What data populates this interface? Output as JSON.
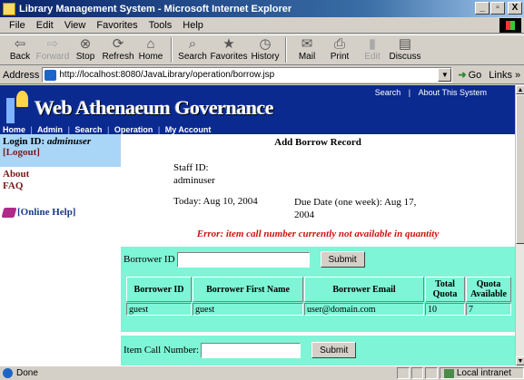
{
  "window": {
    "title": "Library Management System - Microsoft Internet Explorer",
    "minimize": "_",
    "restore": "!",
    "close": "X"
  },
  "menu": [
    "File",
    "Edit",
    "View",
    "Favorites",
    "Tools",
    "Help"
  ],
  "toolbar": {
    "back": "Back",
    "forward": "Forward",
    "stop": "Stop",
    "refresh": "Refresh",
    "home": "Home",
    "search": "Search",
    "favorites": "Favorites",
    "history": "History",
    "mail": "Mail",
    "print": "Print",
    "edit": "Edit",
    "discuss": "Discuss"
  },
  "address": {
    "label": "Address",
    "url": "http://localhost:8080/JavaLibrary/operation/borrow.jsp",
    "go": "Go",
    "links": "Links »"
  },
  "site": {
    "name": "Web Athenaeum Governance",
    "top_links": [
      "Search",
      "|",
      "About This System"
    ],
    "nav": [
      "Home",
      "|",
      "Admin",
      "|",
      "Search",
      "|",
      "Operation",
      "|",
      "My Account"
    ]
  },
  "sidebar": {
    "login_label": "Login ID:",
    "login_user": "adminuser",
    "logout": "[Logout]",
    "about": "About",
    "faq": "FAQ",
    "help": "[Online Help]"
  },
  "page": {
    "title": "Add Borrow Record",
    "staff_label": "Staff ID:",
    "staff_value": "adminuser",
    "today": "Today: Aug 10, 2004",
    "due": "Due Date (one week): Aug 17, 2004",
    "error": "Error: item call number currently not available in quantity"
  },
  "borrower_form": {
    "label": "Borrower ID",
    "value": "",
    "submit": "Submit"
  },
  "table": {
    "headers": [
      "Borrower ID",
      "Borrower First Name",
      "Borrower Email",
      "Total Quota",
      "Quota Available"
    ],
    "rows": [
      [
        "guest",
        "guest",
        "user@domain.com",
        "10",
        "7"
      ]
    ]
  },
  "item_form": {
    "label": "Item Call Number:",
    "value": "",
    "submit": "Submit"
  },
  "status": {
    "text": "Done",
    "zone": "Local intranet"
  }
}
